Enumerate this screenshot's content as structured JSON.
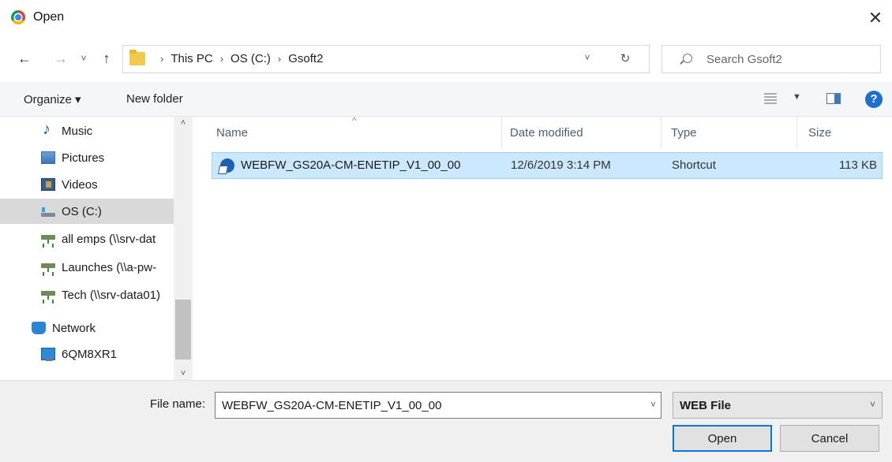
{
  "window": {
    "title": "Open",
    "close_glyph": "✕"
  },
  "nav": {
    "back_glyph": "←",
    "forward_glyph": "→",
    "recent_glyph": "˅",
    "up_glyph": "↑",
    "breadcrumbs": [
      "This PC",
      "OS (C:)",
      "Gsoft2"
    ],
    "crumb_separator": "›",
    "address_dropdown_glyph": "˅",
    "refresh_glyph": "↻",
    "search_placeholder": "Search Gsoft2"
  },
  "toolbar": {
    "organize_label": "Organize ▾",
    "new_folder_label": "New folder",
    "view_dropdown_glyph": "▼",
    "help_glyph": "?"
  },
  "sidebar": {
    "items": [
      {
        "label": "Music",
        "icon": "music-icon"
      },
      {
        "label": "Pictures",
        "icon": "pictures-icon"
      },
      {
        "label": "Videos",
        "icon": "videos-icon"
      },
      {
        "label": "OS (C:)",
        "icon": "drive-icon",
        "selected": true
      },
      {
        "label": "all emps (\\\\srv-dat",
        "icon": "network-drive-icon"
      },
      {
        "label": "Launches (\\\\a-pw-",
        "icon": "network-drive-icon"
      },
      {
        "label": "Tech (\\\\srv-data01)",
        "icon": "network-drive-icon"
      },
      {
        "label": "Network",
        "icon": "network-icon"
      },
      {
        "label": "6QM8XR1",
        "icon": "computer-icon"
      }
    ],
    "scroll_up_glyph": "˄",
    "scroll_down_glyph": "˅"
  },
  "file_list": {
    "columns": [
      "Name",
      "Date modified",
      "Type",
      "Size"
    ],
    "sort_glyph": "^",
    "rows": [
      {
        "name": "WEBFW_GS20A-CM-ENETIP_V1_00_00",
        "date_modified": "12/6/2019 3:14 PM",
        "type": "Shortcut",
        "size": "113 KB",
        "selected": true
      }
    ]
  },
  "footer": {
    "file_name_label": "File name:",
    "file_name_value": "WEBFW_GS20A-CM-ENETIP_V1_00_00",
    "file_name_dropdown_glyph": "˅",
    "file_type_value": "WEB File",
    "file_type_dropdown_glyph": "˅",
    "open_label": "Open",
    "cancel_label": "Cancel"
  },
  "colors": {
    "selection_bg": "#cce8ff",
    "selection_border": "#99d1ff",
    "accent": "#0078d7",
    "sidebar_selected": "#d9d9d9"
  }
}
